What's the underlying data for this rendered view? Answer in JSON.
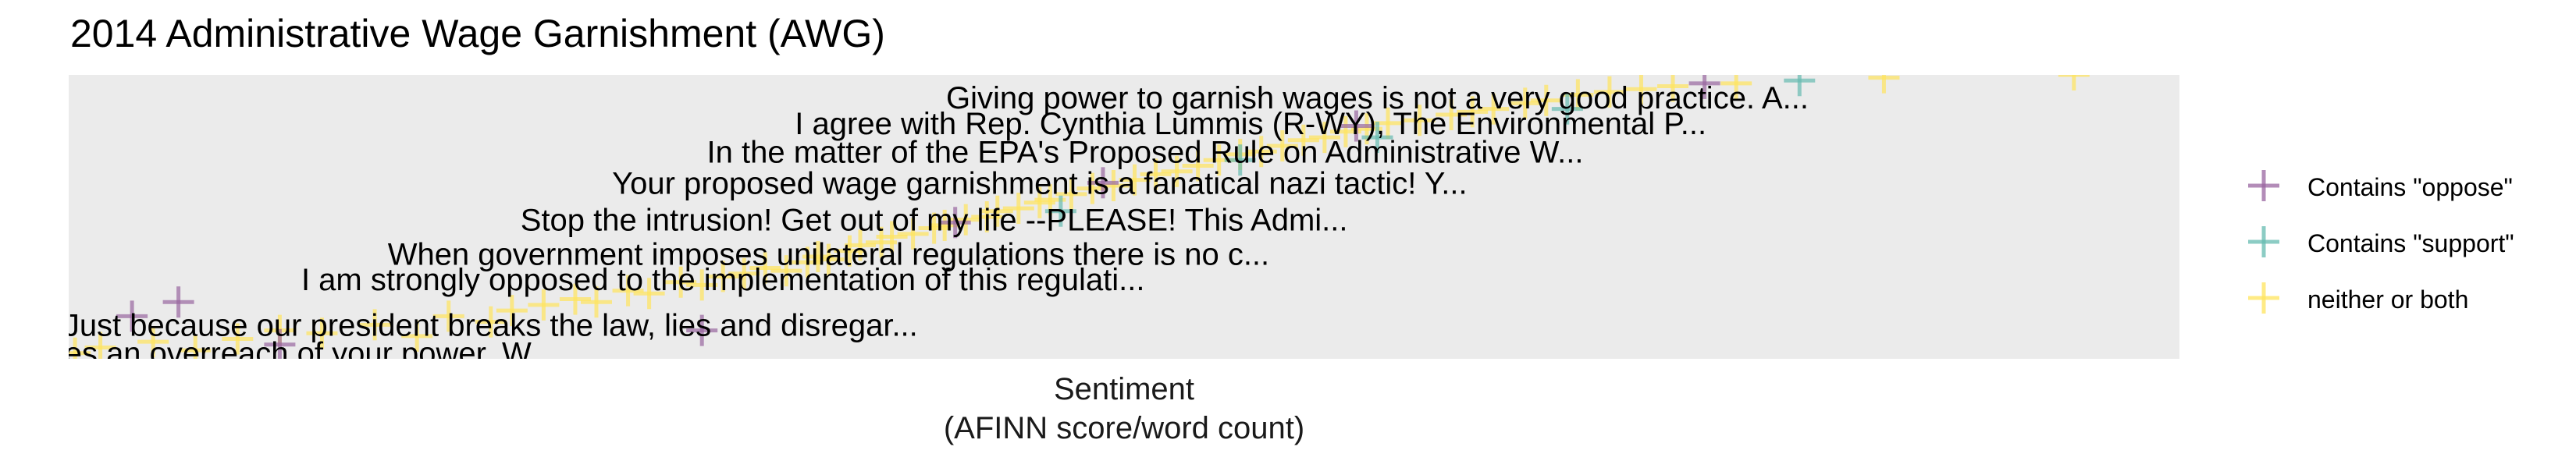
{
  "chart_data": {
    "type": "scatter",
    "title": "2014 Administrative Wage Garnishment (AWG)",
    "xlabel": "Sentiment\n(AFINN score/word count)",
    "ylabel": "",
    "grid": false,
    "legend_position": "right",
    "series": [
      {
        "name": "Contains \"oppose\"",
        "color": "#9966a0",
        "points": [
          [
            0.052,
            0.2
          ],
          [
            0.03,
            0.15
          ],
          [
            0.3,
            0.1
          ],
          [
            0.1,
            0.05
          ],
          [
            0.775,
            0.97
          ],
          [
            0.61,
            0.82
          ],
          [
            0.49,
            0.62
          ],
          [
            0.42,
            0.48
          ]
        ]
      },
      {
        "name": "Contains \"support\"",
        "color": "#66bbb0",
        "points": [
          [
            0.82,
            0.98
          ],
          [
            0.71,
            0.88
          ],
          [
            0.62,
            0.78
          ],
          [
            0.555,
            0.7
          ],
          [
            0.47,
            0.52
          ]
        ]
      },
      {
        "name": "neither or both",
        "color": "#ffe45c",
        "points": [
          [
            0.003,
            0.02
          ],
          [
            0.015,
            0.04
          ],
          [
            0.04,
            0.06
          ],
          [
            0.06,
            0.03
          ],
          [
            0.08,
            0.07
          ],
          [
            0.1,
            0.1
          ],
          [
            0.12,
            0.09
          ],
          [
            0.145,
            0.12
          ],
          [
            0.165,
            0.08
          ],
          [
            0.18,
            0.15
          ],
          [
            0.2,
            0.13
          ],
          [
            0.21,
            0.17
          ],
          [
            0.225,
            0.19
          ],
          [
            0.24,
            0.21
          ],
          [
            0.25,
            0.2
          ],
          [
            0.265,
            0.24
          ],
          [
            0.275,
            0.23
          ],
          [
            0.29,
            0.27
          ],
          [
            0.3,
            0.26
          ],
          [
            0.31,
            0.29
          ],
          [
            0.32,
            0.3
          ],
          [
            0.33,
            0.32
          ],
          [
            0.34,
            0.31
          ],
          [
            0.35,
            0.34
          ],
          [
            0.355,
            0.36
          ],
          [
            0.36,
            0.35
          ],
          [
            0.37,
            0.38
          ],
          [
            0.375,
            0.4
          ],
          [
            0.385,
            0.41
          ],
          [
            0.39,
            0.43
          ],
          [
            0.4,
            0.44
          ],
          [
            0.41,
            0.46
          ],
          [
            0.415,
            0.47
          ],
          [
            0.425,
            0.49
          ],
          [
            0.435,
            0.5
          ],
          [
            0.44,
            0.52
          ],
          [
            0.45,
            0.53
          ],
          [
            0.46,
            0.55
          ],
          [
            0.465,
            0.56
          ],
          [
            0.475,
            0.58
          ],
          [
            0.485,
            0.6
          ],
          [
            0.495,
            0.61
          ],
          [
            0.505,
            0.63
          ],
          [
            0.515,
            0.65
          ],
          [
            0.525,
            0.66
          ],
          [
            0.535,
            0.68
          ],
          [
            0.545,
            0.7
          ],
          [
            0.555,
            0.72
          ],
          [
            0.565,
            0.73
          ],
          [
            0.575,
            0.75
          ],
          [
            0.585,
            0.77
          ],
          [
            0.595,
            0.78
          ],
          [
            0.605,
            0.8
          ],
          [
            0.615,
            0.81
          ],
          [
            0.625,
            0.83
          ],
          [
            0.64,
            0.84
          ],
          [
            0.655,
            0.86
          ],
          [
            0.665,
            0.87
          ],
          [
            0.675,
            0.88
          ],
          [
            0.69,
            0.9
          ],
          [
            0.7,
            0.91
          ],
          [
            0.715,
            0.93
          ],
          [
            0.73,
            0.94
          ],
          [
            0.745,
            0.95
          ],
          [
            0.76,
            0.96
          ],
          [
            0.79,
            0.97
          ],
          [
            0.86,
            0.99
          ],
          [
            0.95,
            1.0
          ]
        ]
      }
    ],
    "annotations": [
      {
        "text": "Giving power to garnish wages is not a very good practice. A...",
        "x": 0.62,
        "y": 0.92
      },
      {
        "text": "I agree with Rep. Cynthia Lummis (R-WY), The Environmental P...",
        "x": 0.56,
        "y": 0.83
      },
      {
        "text": "In the matter of the EPA's Proposed Rule on Administrative W...",
        "x": 0.51,
        "y": 0.73
      },
      {
        "text": "Your proposed wage garnishment is a fanatical nazi tactic! Y...",
        "x": 0.46,
        "y": 0.62
      },
      {
        "text": "Stop the intrusion!  Get out of my life --PLEASE!  This Admi...",
        "x": 0.41,
        "y": 0.49
      },
      {
        "text": "When government imposes unilateral regulations there is no c...",
        "x": 0.36,
        "y": 0.37
      },
      {
        "text": "I am strongly opposed to the implementation of this regulati...",
        "x": 0.31,
        "y": 0.28
      },
      {
        "text": "Just because our president breaks the law, lies and disregar...",
        "x": 0.2,
        "y": 0.12
      },
      {
        "text": "...tutes an overreach of your power. W...",
        "x": 0.1,
        "y": 0.02
      }
    ]
  }
}
